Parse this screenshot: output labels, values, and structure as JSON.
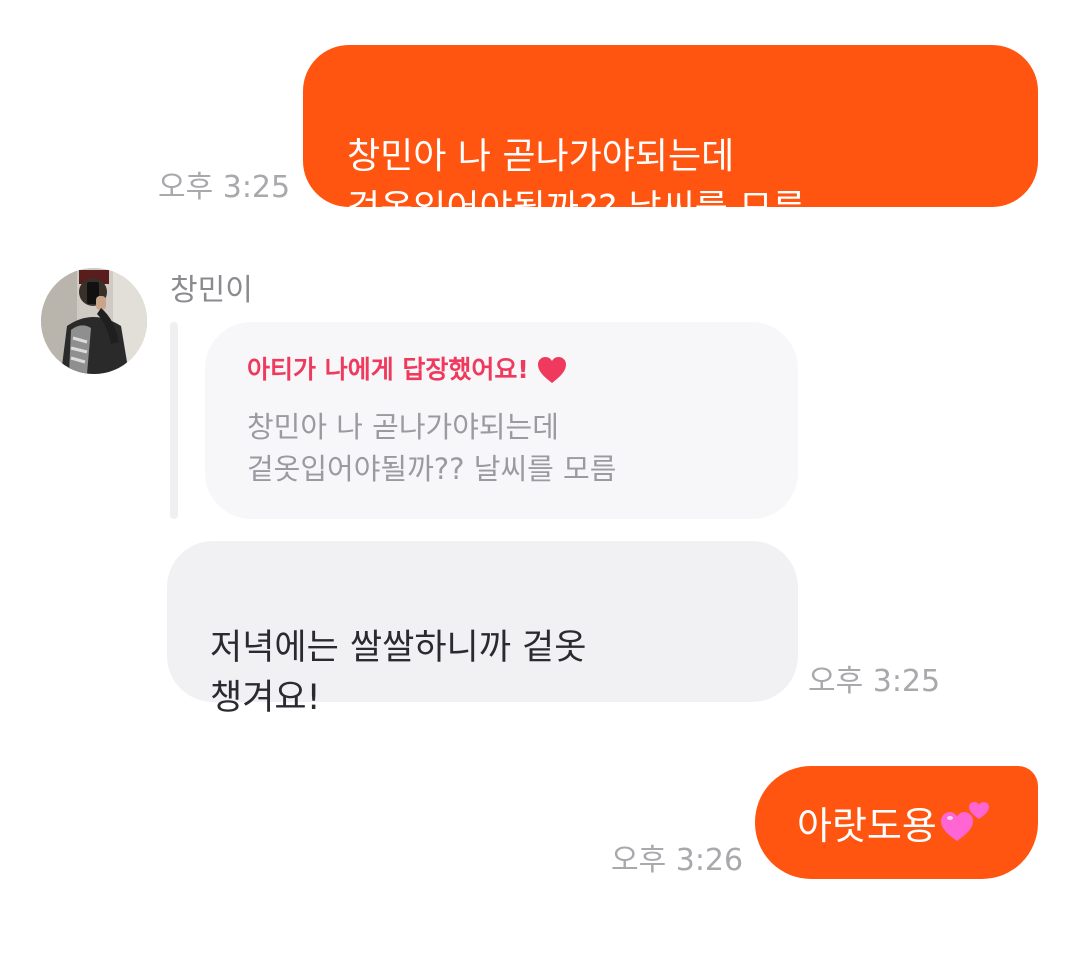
{
  "messages": {
    "out_1": {
      "text": "창민아 나 곧나가야되는데\n겉옷입어야될까?? 날씨를 모름",
      "time": "오후 3:25"
    },
    "incoming": {
      "sender": "창민이",
      "avatar": "profile-photo",
      "reply_quote": {
        "header": "아티가 나에게 답장했어요!",
        "header_icon": "heart-icon",
        "text": "창민아 나 곧나가야되는데\n겉옷입어야될까?? 날씨를 모름"
      },
      "text": "저녁에는 쌀쌀하니까 겉옷\n챙겨요!",
      "time": "오후 3:25"
    },
    "out_2": {
      "text": "아랏도용",
      "emoji": "two-hearts-icon",
      "time": "오후 3:26"
    }
  },
  "colors": {
    "outgoing_bubble": "#ff5510",
    "incoming_bubble": "#f1f1f4",
    "quote_header": "#ef3a5d",
    "timestamp": "#a8a8ad"
  }
}
